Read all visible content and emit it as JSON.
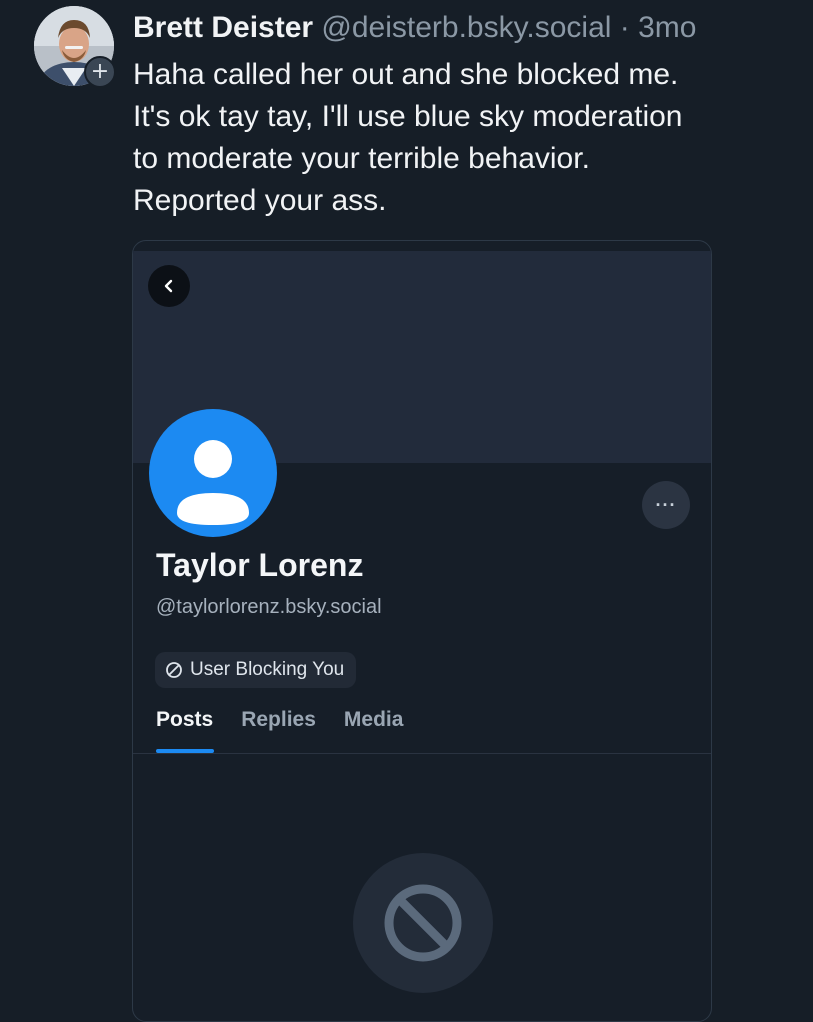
{
  "post": {
    "author_name": "Brett Deister",
    "author_handle": "@deisterb.bsky.social",
    "separator": "·",
    "time": "3mo",
    "follow_icon": "plus-icon",
    "text_lines": [
      "Haha called her out and she blocked me.",
      "It's ok tay tay, I'll use blue sky moderation",
      "to moderate your terrible behavior.",
      "Reported your ass."
    ]
  },
  "embed": {
    "back_icon": "chevron-left-icon",
    "more_icon": "ellipsis-icon",
    "more_label": "···",
    "profile": {
      "name": "Taylor Lorenz",
      "handle": "@taylorlorenz.bsky.social",
      "avatar_icon": "default-user-icon",
      "avatar_color": "#1c8af2"
    },
    "blocking_badge": {
      "icon": "block-icon",
      "label": "User Blocking You"
    },
    "tabs": [
      {
        "label": "Posts",
        "active": true
      },
      {
        "label": "Replies",
        "active": false
      },
      {
        "label": "Media",
        "active": false
      }
    ],
    "empty_state_icon": "block-icon"
  },
  "colors": {
    "background": "#161e27",
    "accent": "#1c8af2",
    "muted_text": "#8b98a5"
  }
}
